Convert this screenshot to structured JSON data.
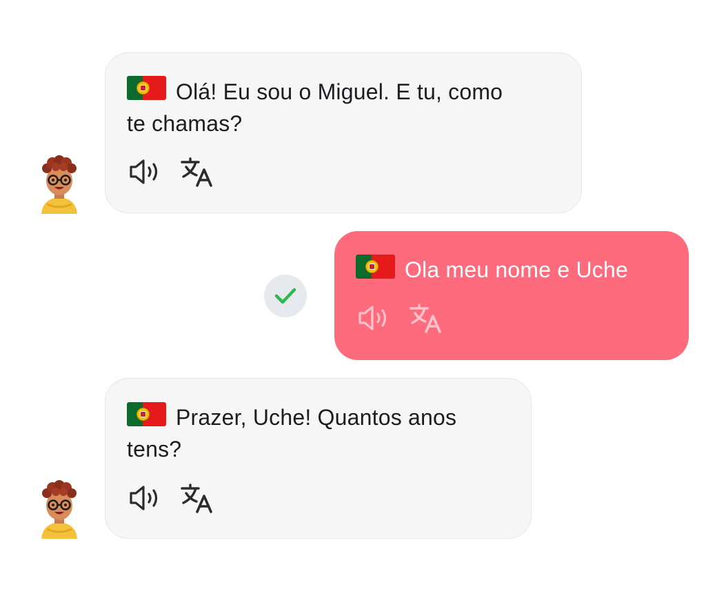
{
  "messages": [
    {
      "role": "bot",
      "lines": [
        "Olá! Eu sou o Miguel. E tu, como",
        "te chamas?"
      ],
      "flag": "portugal-flag-icon"
    },
    {
      "role": "user",
      "lines": [
        "Ola meu nome e Uche"
      ],
      "flag": "portugal-flag-icon",
      "status": "check-icon"
    },
    {
      "role": "bot",
      "lines": [
        "Prazer, Uche! Quantos anos",
        "tens?"
      ],
      "flag": "portugal-flag-icon"
    }
  ],
  "icons": {
    "play_audio": "speaker-icon",
    "translate": "translate-icon",
    "status": "check-icon",
    "avatar": "avatar-icon"
  },
  "colors": {
    "bot_bubble": "#f6f6f6",
    "user_bubble": "#fd6b7d",
    "check": "#2fb84c",
    "text": "#1d1d1f"
  }
}
